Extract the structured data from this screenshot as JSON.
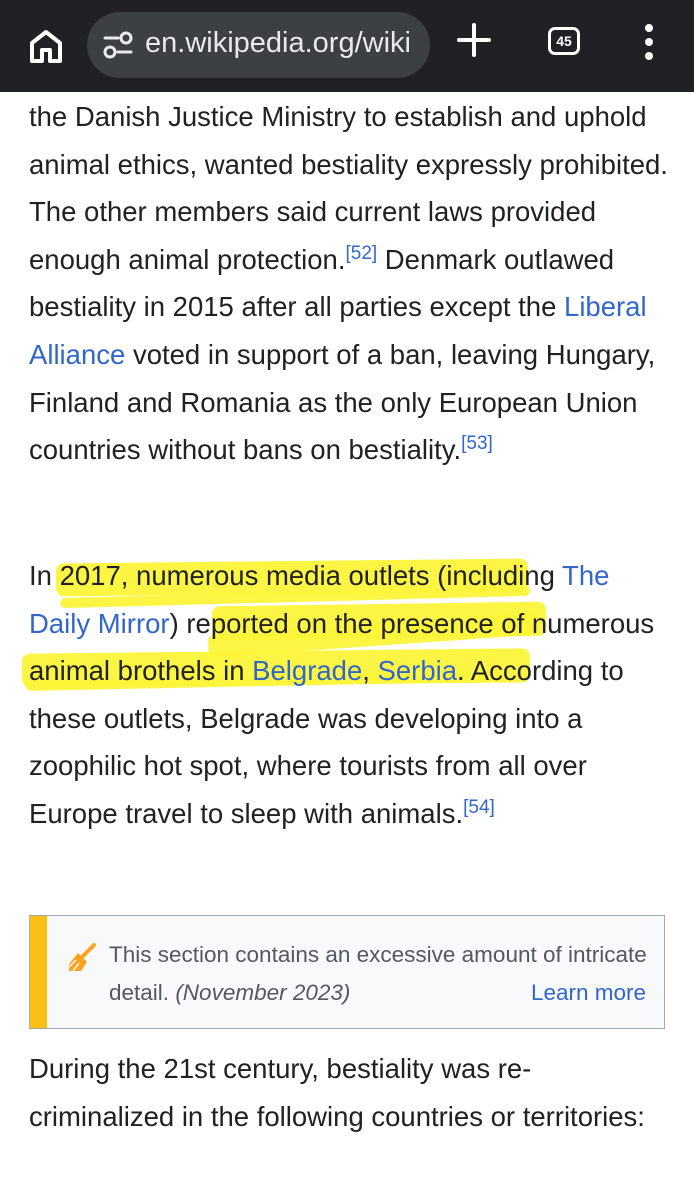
{
  "browser": {
    "url": "en.wikipedia.org/wiki",
    "tab_count": "45",
    "icons": [
      "home-icon",
      "site-settings-icon",
      "plus-icon",
      "tab-switcher-icon",
      "more-vert-icon"
    ]
  },
  "article": {
    "para1": {
      "t1": "the Danish Justice Ministry to establish and uphold animal ethics, wanted bestiality expressly prohibited. The other members said current laws provided enough animal protection.",
      "ref1": "[52]",
      "t2": " Denmark outlawed bestiality in 2015 after all parties except the ",
      "link1": "Liberal Alliance",
      "t3": " voted in support of a ban, leaving Hungary, Finland and Romania as the only European Union countries without bans on bestiality.",
      "ref2": "[53]"
    },
    "para2": {
      "t1": "In 2017, numerous media outlets (including ",
      "link1": "The Daily Mirror",
      "t2": ") reported on the presence of numerous animal brothels in ",
      "link2": "Belgrade",
      "t3": ", ",
      "link3": "Serbia",
      "t4": ". According to these outlets, Belgrade was developing into a zoophilic hot spot, where tourists from all over Europe travel to sleep with animals.",
      "ref1": "[54]"
    },
    "notice": {
      "text": "This section contains an excessive amount of intricate detail.",
      "date": "(November 2023)",
      "learn_more": "Learn more",
      "icon": "broom-icon"
    },
    "para3": {
      "t1": "During the 21st century, bestiality was re-criminalized in the following countries or territories:"
    }
  },
  "colors": {
    "link": "#3366cc",
    "highlight": "#fcf43a",
    "notice_bar": "#fcbf14",
    "toolbar": "#202124"
  }
}
